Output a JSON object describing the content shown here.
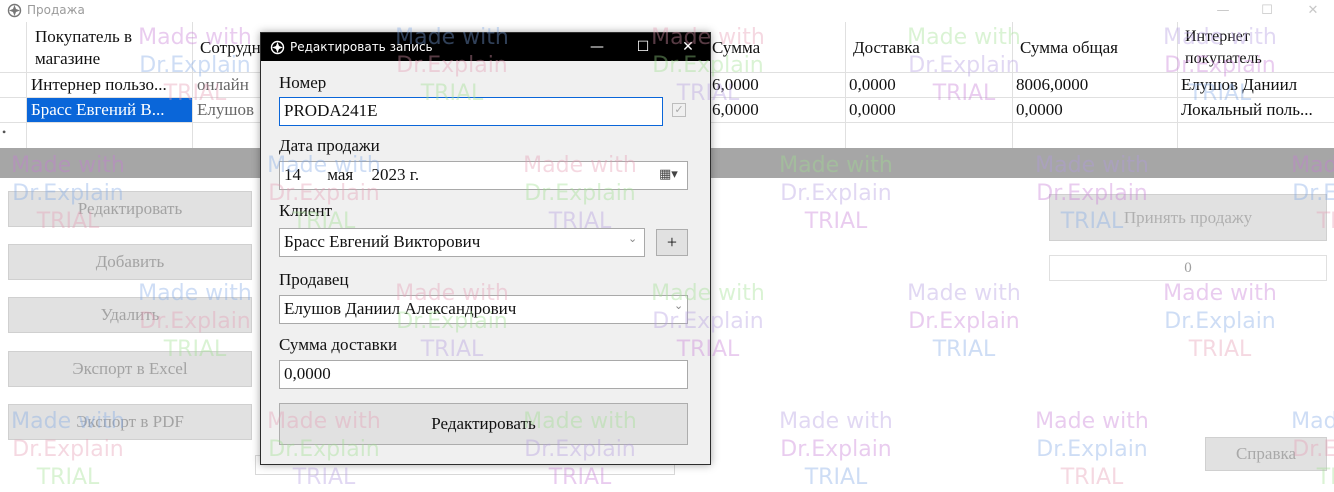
{
  "window": {
    "title": "Продажа",
    "minimize_glyph": "—",
    "maximize_glyph": "☐",
    "close_glyph": "✕"
  },
  "grid": {
    "headers": [
      "Покупатель в магазине",
      "Сотрудник",
      "Сумма",
      "Доставка",
      "Сумма общая",
      "Интернет покупатель"
    ],
    "rows": [
      {
        "customer": "Интернер пользо...",
        "employee": "онлайн",
        "sum": "6,0000",
        "delivery": "0,0000",
        "total": "8006,0000",
        "internet_customer": "Елушов Даниил"
      },
      {
        "customer": "Брасс Евгений В...",
        "employee": "Елушов",
        "sum": "6,0000",
        "delivery": "0,0000",
        "total": "0,0000",
        "internet_customer": "Локальный поль..."
      }
    ]
  },
  "side_buttons": {
    "edit": "Редактировать",
    "add": "Добавить",
    "delete": "Удалить",
    "export_excel": "Экспорт в Excel",
    "export_pdf": "Экспорт в PDF"
  },
  "right_panel": {
    "accept_sale": "Принять продажу",
    "count": "0",
    "help": "Справка"
  },
  "dialog": {
    "title": "Редактировать запись",
    "number_label": "Номер",
    "number_value": "PRODA241E",
    "date_label": "Дата продажи",
    "date_day": "14",
    "date_month": "мая",
    "date_year": "2023 г.",
    "client_label": "Клиент",
    "client_value": "Брасс Евгений Викторович",
    "add_client_glyph": "+",
    "seller_label": "Продавец",
    "seller_value": "Елушов Даниил Александрович",
    "delivery_label": "Сумма доставки",
    "delivery_value": "0,0000",
    "submit": "Редактировать"
  },
  "watermark": {
    "line1": "Made with",
    "line2": "Dr.Explain",
    "line3": "TRIAL"
  },
  "colors": {
    "selection": "#0a66d9",
    "dialog_title_bg": "#000000",
    "grid_bar": "#a6a6a6",
    "watermark_palette": [
      "#c77bd6",
      "#7fa8e6",
      "#e59bb3",
      "#9fe08f",
      "#b39be0"
    ]
  }
}
